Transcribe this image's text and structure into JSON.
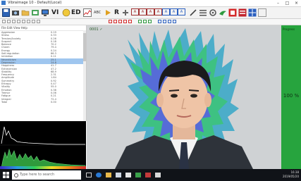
{
  "window": {
    "title": "Vibraimage 10 - Default(Local)",
    "controls": [
      "–",
      "□",
      "×"
    ]
  },
  "toolbar": {
    "vi_label": "VI",
    "ed_label": "ED",
    "abc_label": "ABC",
    "r_label": "R",
    "mode_badges": [
      "A",
      "A",
      "A",
      "A",
      "A",
      "A",
      "A"
    ]
  },
  "left_panel": {
    "menu": "File Edit View Help",
    "parameters": [
      {
        "label": "Aggression",
        "value": "0.19"
      },
      {
        "label": "Stress",
        "value": "0.33"
      },
      {
        "label": "Tension/Anxiety",
        "value": "0.26"
      },
      {
        "label": "Suspect",
        "value": "0.18"
      },
      {
        "label": "Balance",
        "value": "70.2"
      },
      {
        "label": "Charm",
        "value": "79.4"
      },
      {
        "label": "Energy",
        "value": "0.24"
      },
      {
        "label": "Self-regulation",
        "value": "86.3"
      },
      {
        "label": "Inhibition",
        "value": "0.11"
      },
      {
        "label": "Neuroticism",
        "value": "25.1"
      },
      {
        "label": "Depression",
        "value": "24.8"
      },
      {
        "label": "Happiness",
        "value": "41.7"
      },
      {
        "label": "Extraversion",
        "value": "47.2"
      },
      {
        "label": "Stability",
        "value": "68.9"
      },
      {
        "label": "Frequency",
        "value": "2.31"
      },
      {
        "label": "Amplitude",
        "value": "1.84"
      },
      {
        "label": "Symmetry",
        "value": "0.92"
      },
      {
        "label": "Entropy",
        "value": "0.47"
      },
      {
        "label": "Vitality",
        "value": "55.0"
      },
      {
        "label": "Emotion",
        "value": "0.38"
      },
      {
        "label": "Tremor",
        "value": "0.06"
      },
      {
        "label": "Fatigue",
        "value": "0.21"
      },
      {
        "label": "Integral",
        "value": "72.4"
      },
      {
        "label": "Total",
        "value": "0.00"
      }
    ]
  },
  "main_view": {
    "frame_label": "0001 ✓"
  },
  "right_panel": {
    "label": "Progress",
    "value": "100 %"
  },
  "taskbar": {
    "search_placeholder": "Type here to search",
    "time": "16:38",
    "date": "2019/05/20"
  }
}
